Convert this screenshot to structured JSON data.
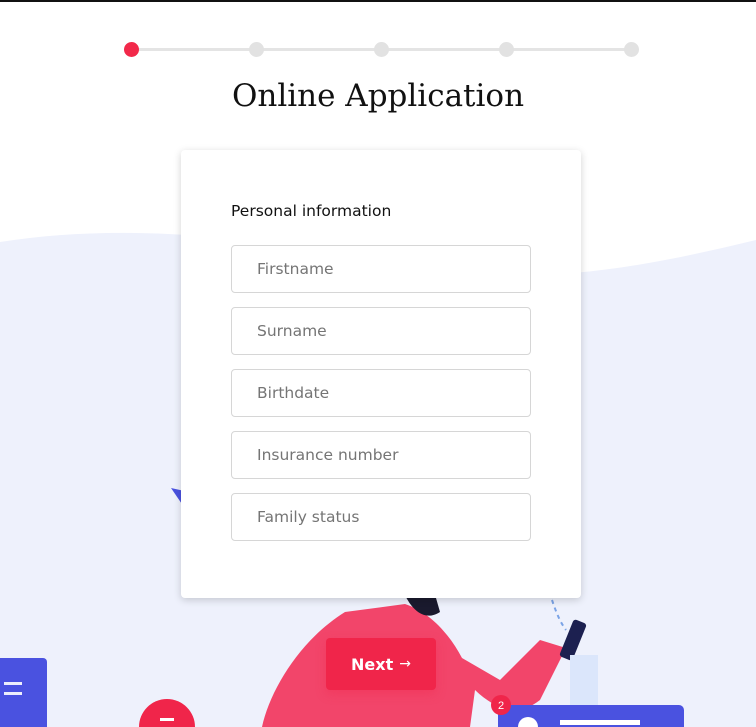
{
  "page": {
    "title": "Online Application"
  },
  "stepper": {
    "steps": [
      {
        "state": "active"
      },
      {
        "state": "inactive"
      },
      {
        "state": "inactive"
      },
      {
        "state": "inactive"
      },
      {
        "state": "inactive"
      }
    ],
    "active_color": "#f2294a",
    "inactive_color": "#e2e2e2"
  },
  "form": {
    "section_label": "Personal information",
    "fields": [
      {
        "placeholder": "Firstname",
        "value": ""
      },
      {
        "placeholder": "Surname",
        "value": ""
      },
      {
        "placeholder": "Birthdate",
        "value": ""
      },
      {
        "placeholder": "Insurance number",
        "value": ""
      },
      {
        "placeholder": "Family status",
        "value": ""
      }
    ]
  },
  "actions": {
    "next_label": "Next",
    "next_arrow": "→"
  },
  "illustration": {
    "notification_badge": "2"
  },
  "colors": {
    "accent": "#f0254a",
    "background_wave": "#eef1fc",
    "illustration_blue": "#4a52e0"
  }
}
